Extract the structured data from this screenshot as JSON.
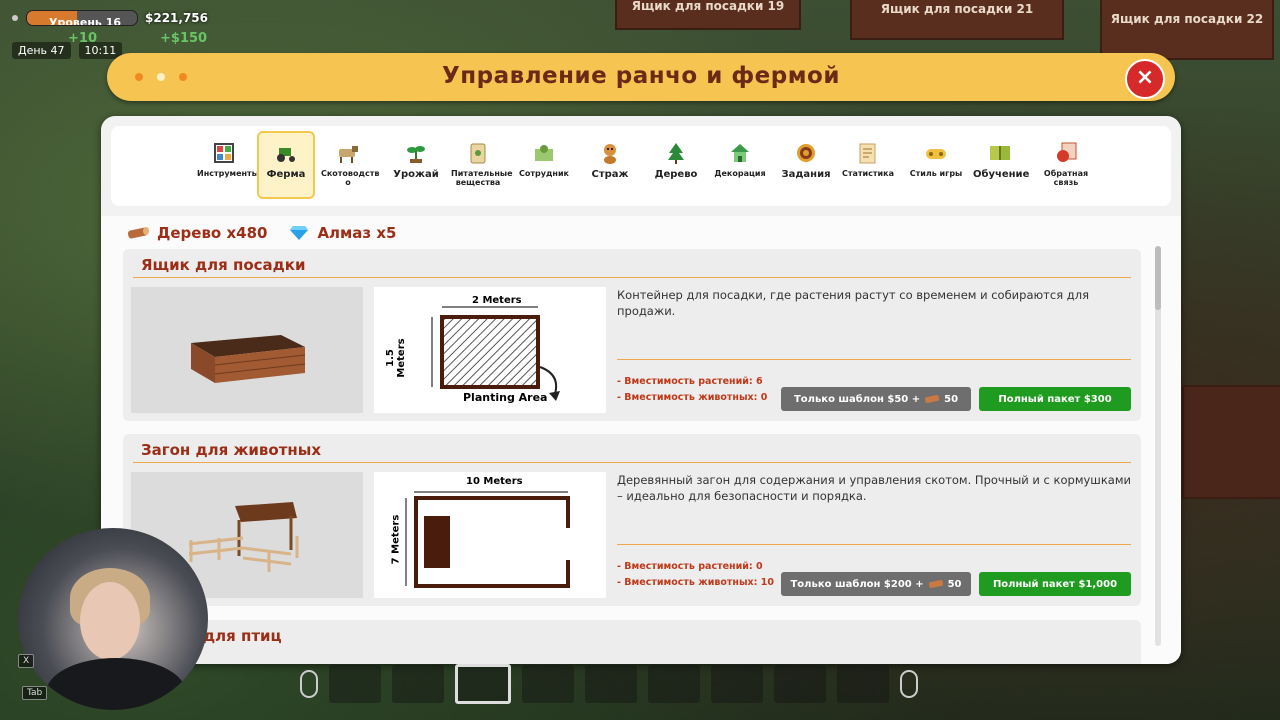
{
  "hud": {
    "level_label": "Уровень 16",
    "level_progress": 0.45,
    "money": "$221,756",
    "money_gain": "+$150",
    "money_gain_small": "+10",
    "day": "День 47",
    "time": "10:11",
    "key_x": "X",
    "key_tab": "Tab"
  },
  "background_signs": [
    "Ящик для посадки 19",
    "Ящик для посадки 21",
    "Ящик для посадки 22"
  ],
  "window": {
    "title": "Управление ранчо и фермой",
    "close_icon": "×"
  },
  "tabs": [
    {
      "label": "Инструменты",
      "icon": "tools-icon",
      "active": false
    },
    {
      "label": "Ферма",
      "icon": "tractor-icon",
      "active": true
    },
    {
      "label": "Скотоводств о",
      "icon": "cow-icon",
      "active": false
    },
    {
      "label": "Урожай",
      "icon": "sprout-icon",
      "active": false
    },
    {
      "label": "Питательные вещества",
      "icon": "fertilizer-icon",
      "active": false
    },
    {
      "label": "Сотрудник",
      "icon": "worker-icon",
      "active": false
    },
    {
      "label": "Страж",
      "icon": "dog-icon",
      "active": false
    },
    {
      "label": "Дерево",
      "icon": "tree-icon",
      "active": false
    },
    {
      "label": "Декорация",
      "icon": "house-icon",
      "active": false
    },
    {
      "label": "Задания",
      "icon": "target-icon",
      "active": false
    },
    {
      "label": "Статистика",
      "icon": "stats-icon",
      "active": false
    },
    {
      "label": "Стиль игры",
      "icon": "gamepad-icon",
      "active": false
    },
    {
      "label": "Обучение",
      "icon": "book-icon",
      "active": false
    },
    {
      "label": "Обратная связь",
      "icon": "bug-icon",
      "active": false
    }
  ],
  "resources": {
    "wood": "Дерево x480",
    "diamond": "Алмаз x5"
  },
  "items": [
    {
      "title": "Ящик для посадки",
      "description": "Контейнер для посадки, где растения растут со временем и собираются для продажи.",
      "plant_capacity": "- Вместимость растений: 6",
      "animal_capacity": "- Вместимость животных: 0",
      "template_button": "Только шаблон $50 +",
      "template_wood": "50",
      "full_button": "Полный пакет $300",
      "diagram": {
        "width_label": "2 Meters",
        "height_label": "1.5 Meters",
        "area_label": "Planting Area"
      }
    },
    {
      "title": "Загон для животных",
      "description": "Деревянный загон для содержания и управления скотом. Прочный и с кормушками – идеально для безопасности и порядка.",
      "plant_capacity": "- Вместимость растений: 0",
      "animal_capacity": "- Вместимость животных: 10",
      "template_button": "Только шаблон $200 +",
      "template_wood": "50",
      "full_button": "Полный пакет $1,000",
      "diagram": {
        "width_label": "10 Meters",
        "height_label": "7 Meters"
      }
    },
    {
      "title": "для птиц"
    }
  ],
  "colors": {
    "accent_title": "#9c2d16",
    "title_bar": "#f6c451",
    "full_button": "#1f9c1f",
    "template_button": "#6e6e6e",
    "close_button": "#d62a2a"
  }
}
